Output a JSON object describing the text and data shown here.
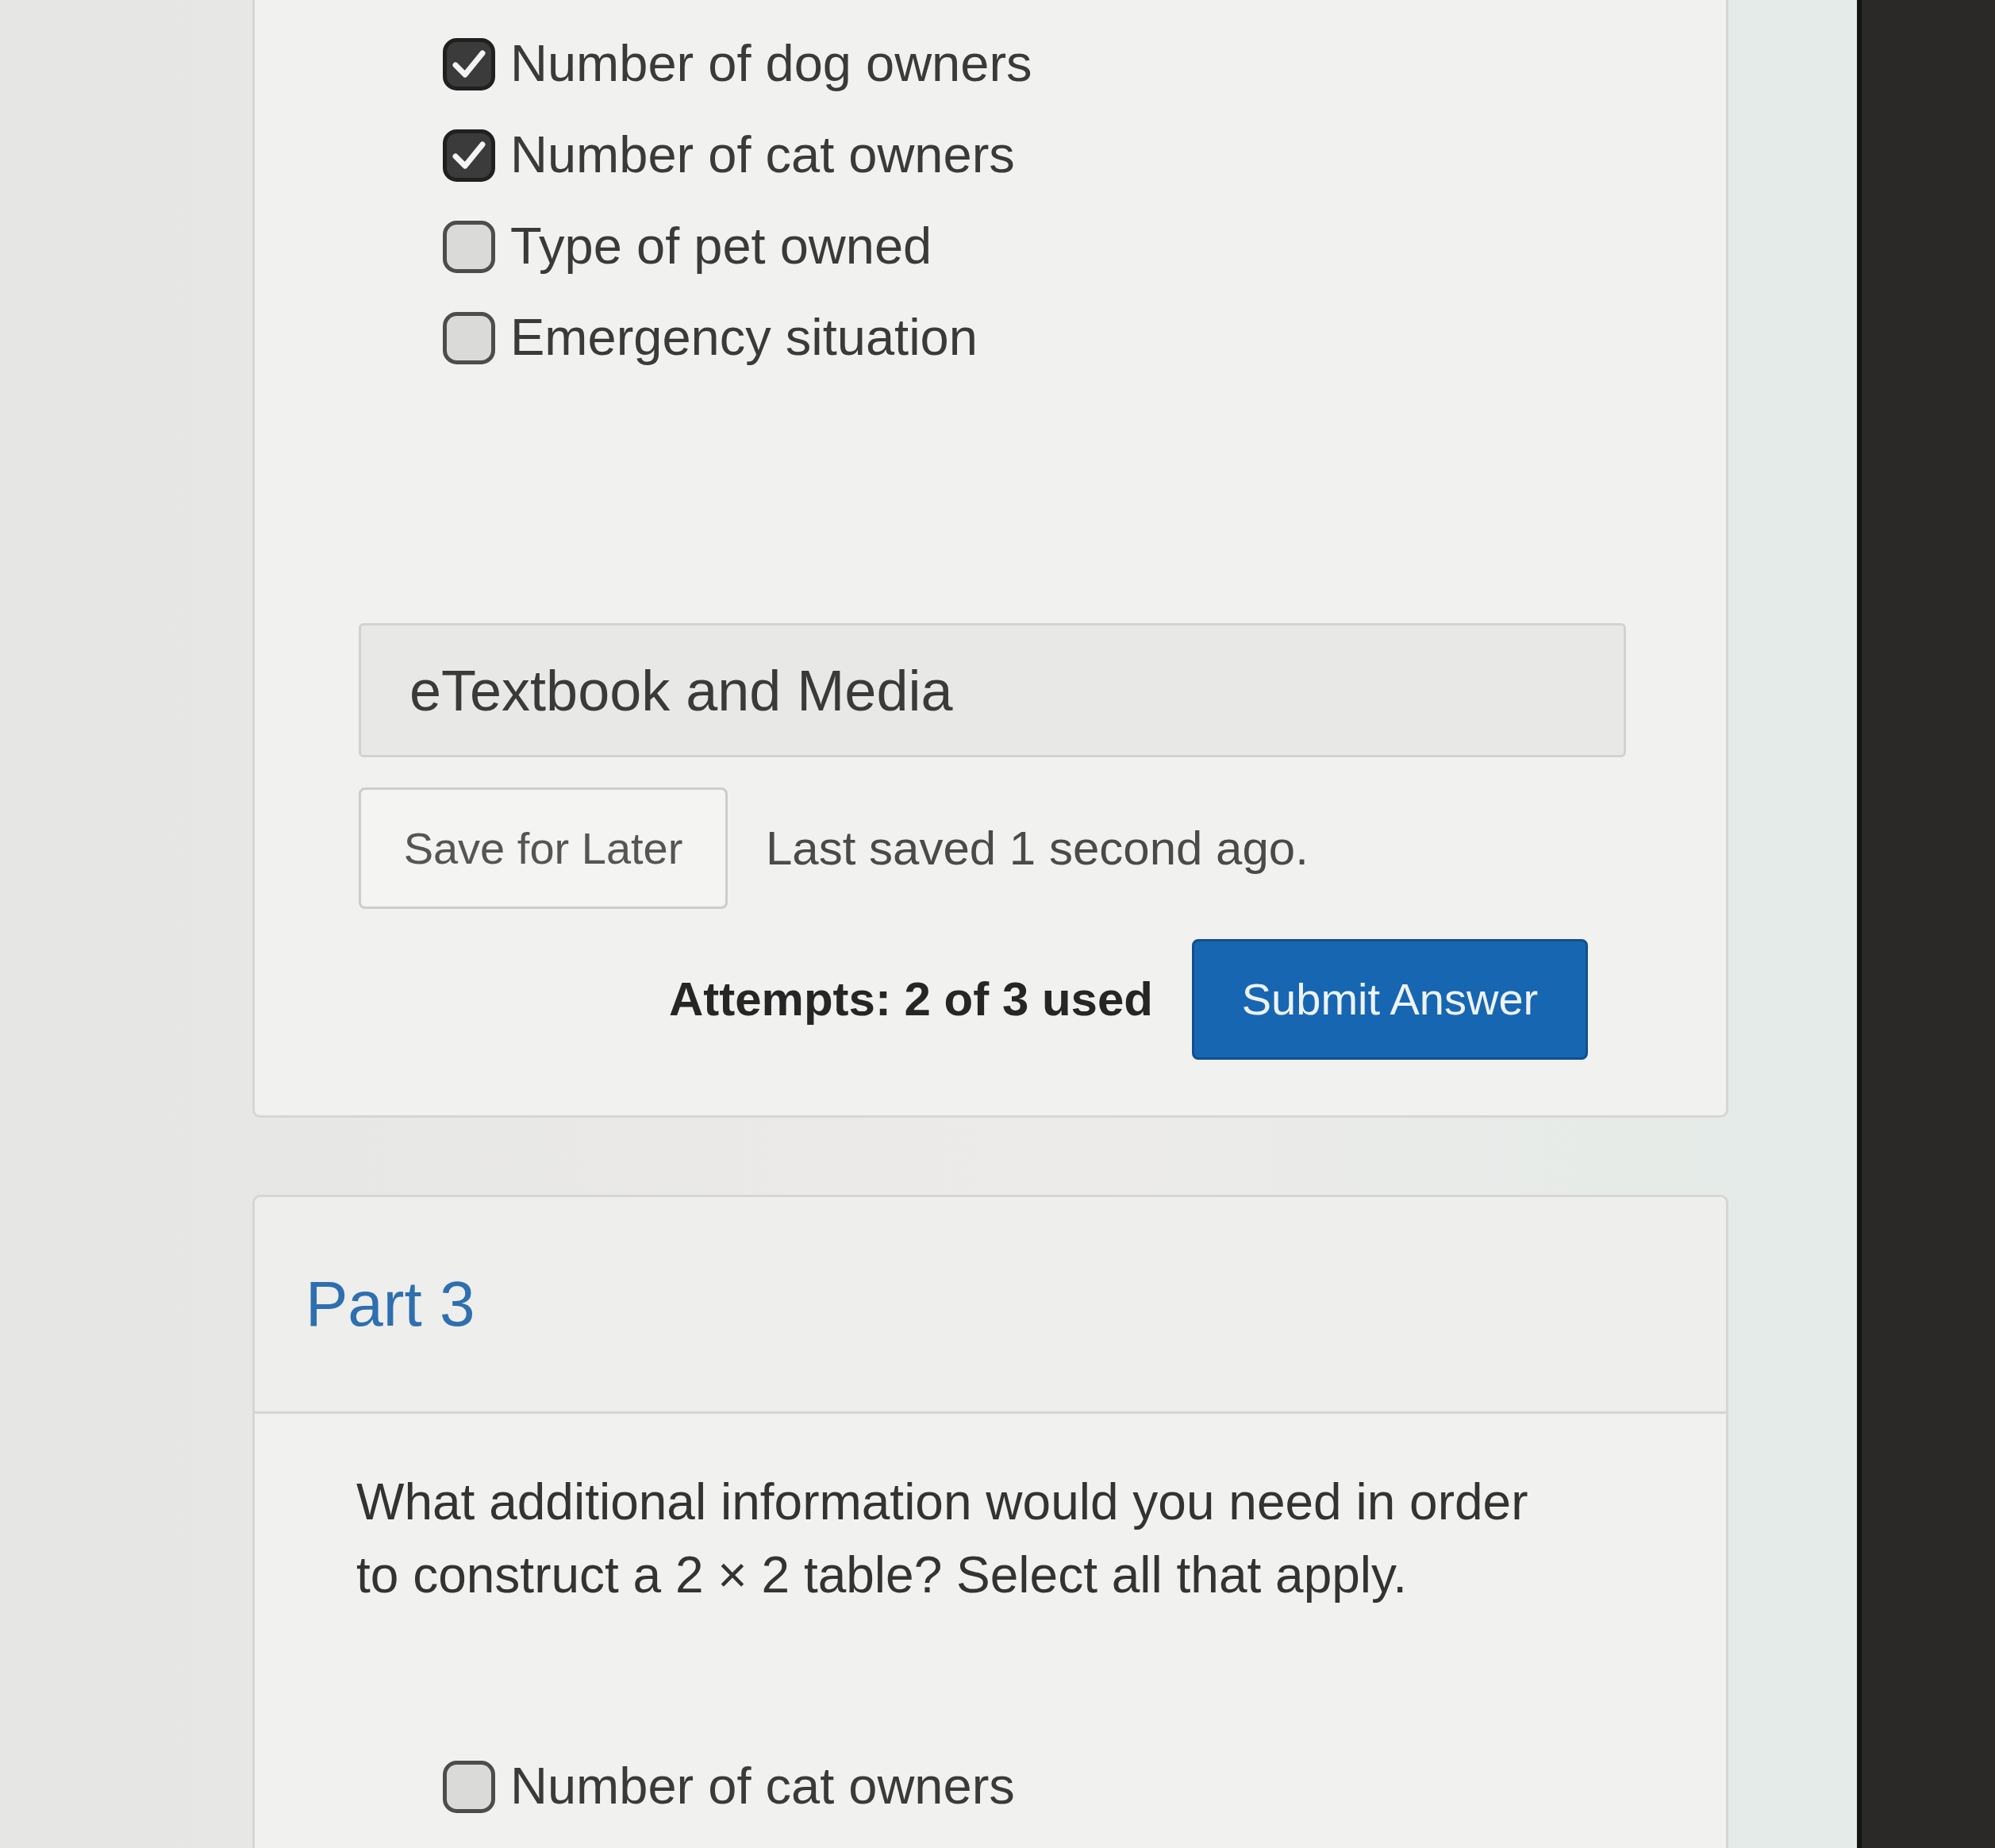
{
  "previous_question": {
    "options": [
      {
        "label": "Number of dog owners",
        "checked": true
      },
      {
        "label": "Number of cat owners",
        "checked": true
      },
      {
        "label": "Type of pet owned",
        "checked": false
      },
      {
        "label": "Emergency situation",
        "checked": false
      }
    ],
    "etextbook_bar": "eTextbook and Media",
    "save_button": "Save for Later",
    "save_status": "Last saved 1 second ago.",
    "attempts": "Attempts: 2 of 3 used",
    "submit_button": "Submit Answer"
  },
  "part_3": {
    "title": "Part 3",
    "question": "What additional information would you need in order to construct a 2 × 2 table? Select all that apply.",
    "options": [
      {
        "label": "Number of cat owners",
        "checked": false
      }
    ]
  }
}
